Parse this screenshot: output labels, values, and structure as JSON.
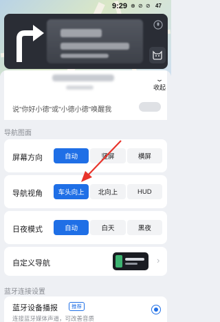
{
  "status_bar": {
    "time": "9:29",
    "icons": "⊕ ⊘ ⊘",
    "battery": "47"
  },
  "guide": {
    "turn": "right-turn-arrow-icon"
  },
  "header": {
    "collapse_label": "收起"
  },
  "wake": {
    "text": "说\"你好小德\"或\"小德小德\"唤醒我",
    "enabled": false
  },
  "sections": {
    "nav_view": "导航图面",
    "bluetooth": "蓝牙连接设置"
  },
  "screen_orientation": {
    "label": "屏幕方向",
    "options": [
      "自动",
      "竖屏",
      "横屏"
    ],
    "selected": "自动"
  },
  "nav_perspective": {
    "label": "导航视角",
    "options": [
      "车头向上",
      "北向上",
      "HUD"
    ],
    "selected": "车头向上"
  },
  "day_night": {
    "label": "日夜模式",
    "options": [
      "自动",
      "白天",
      "黑夜"
    ],
    "selected": "自动"
  },
  "custom_nav": {
    "label": "自定义导航"
  },
  "bluetooth": {
    "title": "蓝牙设备播报",
    "badge": "推荐",
    "subtitle": "连接蓝牙媒体声道，可改善音质",
    "selected": true
  },
  "colors": {
    "accent": "#1f6fe6",
    "annotation": "#e8342b",
    "card_bg": "#ffffff",
    "page_bg": "#eef0f4"
  }
}
